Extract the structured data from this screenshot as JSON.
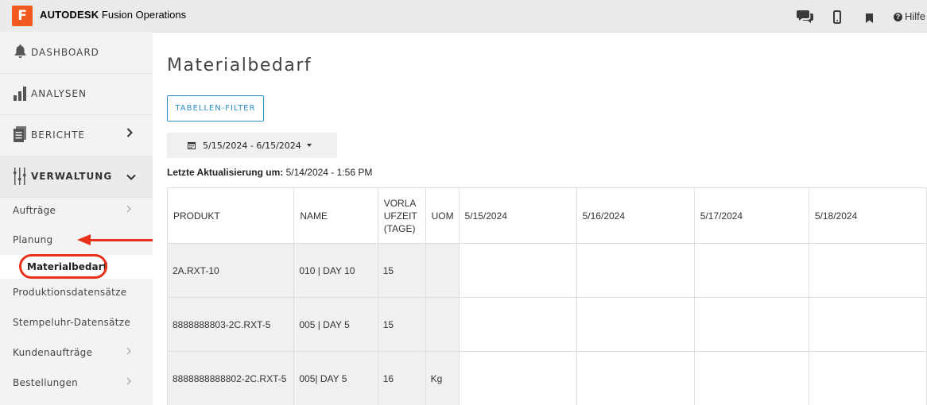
{
  "app": {
    "brand_bold": "AUTODESK",
    "brand_rest": " Fusion Operations",
    "logo_letter": "F",
    "help_label": "Hilfe"
  },
  "sidebar": {
    "main_items": [
      {
        "label": "DASHBOARD",
        "icon": "bell-icon"
      },
      {
        "label": "ANALYSEN",
        "icon": "bar-chart-icon"
      },
      {
        "label": "BERICHTE",
        "icon": "document-icon"
      },
      {
        "label": "VERWALTUNG",
        "icon": "sliders-icon"
      }
    ],
    "sub_items": [
      {
        "label": "Aufträge"
      },
      {
        "label": "Planung"
      },
      {
        "label": "Materialbedarf"
      },
      {
        "label": "Produktionsdatensätze"
      },
      {
        "label": "Stempeluhr-Datensätze"
      },
      {
        "label": "Kundenaufträge"
      },
      {
        "label": "Bestellungen"
      }
    ]
  },
  "main": {
    "title": "Materialbedarf",
    "filter_button": "TABELLEN-FILTER",
    "date_range": "5/15/2024 - 6/15/2024",
    "last_update_label": "Letzte Aktualisierung um:",
    "last_update_value": " 5/14/2024 - 1:56 PM"
  },
  "table": {
    "headers": [
      "PRODUKT",
      "NAME",
      "VORLAUFZEIT (TAGE)",
      "UOM",
      "5/15/2024",
      "5/16/2024",
      "5/17/2024",
      "5/18/2024"
    ],
    "lead_time_header_lines": [
      "VORLA",
      "UFZEIT",
      "(TAGE)"
    ],
    "rows": [
      {
        "produkt": "2A.RXT-10",
        "name": "010 | DAY 10",
        "lead": "15",
        "uom": ""
      },
      {
        "produkt": "8888888803-2C.RXT-5",
        "name": "005 | DAY 5",
        "lead": "15",
        "uom": ""
      },
      {
        "produkt": "8888888888802-2C.RXT-5",
        "name": "005| DAY 5",
        "lead": "16",
        "uom": "Kg"
      }
    ]
  },
  "colors": {
    "accent": "#2b8ec7",
    "logo": "#f05a1e",
    "annotation": "#e8311a"
  }
}
